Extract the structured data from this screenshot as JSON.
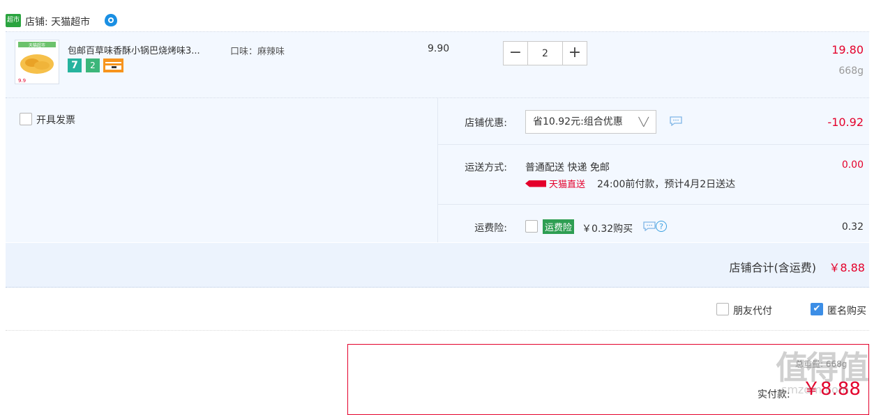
{
  "shop": {
    "logo_text": "超市",
    "label": "店铺: 天猫超市"
  },
  "item": {
    "title": "包邮百草味香酥小锅巴烧烤味3...",
    "sku": "口味：麻辣味",
    "thumb_text": "天猫超市",
    "thumb_price": "9.9",
    "unit_price": "9.90",
    "quantity": "2",
    "subtotal": "19.80",
    "weight": "668g",
    "badges": [
      "7",
      "2"
    ]
  },
  "options": {
    "invoice_label": "开具发票",
    "discount_label": "店铺优惠:",
    "discount_select": "省10.92元:组合优惠",
    "discount_amount": "-10.92",
    "shipping_label": "运送方式:",
    "shipping_method": "普通配送 快递 免邮",
    "tmall_express": "天猫直送",
    "shipping_eta": "24:00前付款，预计4月2日送达",
    "shipping_amount": "0.00",
    "insurance_label": "运费险:",
    "insurance_badge": "运费险",
    "insurance_text": "￥0.32购买",
    "insurance_amount": "0.32"
  },
  "total": {
    "label": "店铺合计(含运费)",
    "amount": "￥8.88"
  },
  "checkout": {
    "friend_pay_label": "朋友代付",
    "anonymous_label": "匿名购买",
    "anonymous_checked": true,
    "paid_label": "实付款:",
    "paid_amount": "￥8.88",
    "paid_weight": "总重量: 668g",
    "watermark": "值得值",
    "watermark_url": "smzdm.com"
  },
  "colors": {
    "accent": "#e4002b",
    "tmall_green": "#2aa43f",
    "check_blue": "#3c8ee6"
  }
}
